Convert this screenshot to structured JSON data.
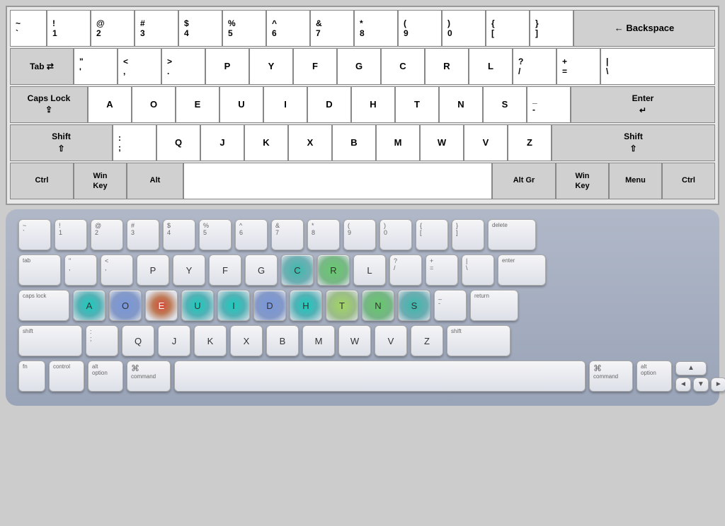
{
  "topKeyboard": {
    "rows": [
      {
        "id": "row1",
        "keys": [
          {
            "id": "tilde",
            "top": "~",
            "bot": "`",
            "cls": "r1-tilde"
          },
          {
            "id": "k1",
            "top": "!",
            "bot": "1",
            "cls": "r1-1"
          },
          {
            "id": "k2",
            "top": "@",
            "bot": "2",
            "cls": "r1-2"
          },
          {
            "id": "k3",
            "top": "#",
            "bot": "3",
            "cls": "r1-3"
          },
          {
            "id": "k4",
            "top": "$",
            "bot": "4",
            "cls": "r1-4"
          },
          {
            "id": "k5",
            "top": "%",
            "bot": "5",
            "cls": "r1-5"
          },
          {
            "id": "k6",
            "top": "^",
            "bot": "6",
            "cls": "r1-6"
          },
          {
            "id": "k7",
            "top": "&",
            "bot": "7",
            "cls": "r1-7"
          },
          {
            "id": "k8",
            "top": "*",
            "bot": "8",
            "cls": "r1-8"
          },
          {
            "id": "k9",
            "top": "(",
            "bot": "9",
            "cls": "r1-9"
          },
          {
            "id": "k0",
            "top": ")",
            "bot": "0",
            "cls": "r1-0"
          },
          {
            "id": "klb",
            "top": "{",
            "bot": "[",
            "cls": "r1-lb"
          },
          {
            "id": "krb",
            "top": "}",
            "bot": "]",
            "cls": "r1-rb"
          },
          {
            "id": "kbs",
            "label": "← Backspace",
            "cls": "r1-bs special"
          }
        ]
      },
      {
        "id": "row2",
        "keys": [
          {
            "id": "tab",
            "label": "Tab ⇄",
            "cls": "r2-tab special"
          },
          {
            "id": "kq",
            "top": "\"",
            "bot": "'",
            "cls": "r2-q"
          },
          {
            "id": "kw",
            "top": "<",
            "bot": ",",
            "cls": "r2-w"
          },
          {
            "id": "ke",
            "top": ">",
            "bot": ".",
            "cls": "r2-e"
          },
          {
            "id": "kr",
            "label": "P",
            "cls": "r2-r"
          },
          {
            "id": "kt",
            "label": "Y",
            "cls": "r2-t"
          },
          {
            "id": "ky",
            "label": "F",
            "cls": "r2-y"
          },
          {
            "id": "ku",
            "label": "G",
            "cls": "r2-u"
          },
          {
            "id": "ki",
            "label": "C",
            "cls": "r2-i"
          },
          {
            "id": "ko",
            "label": "R",
            "cls": "r2-o"
          },
          {
            "id": "kp",
            "label": "L",
            "cls": "r2-p"
          },
          {
            "id": "klb2",
            "top": "?",
            "bot": "/",
            "cls": "r2-lb2"
          },
          {
            "id": "krb2",
            "top": "+",
            "bot": "=",
            "cls": "r2-rb2"
          },
          {
            "id": "kbs2",
            "top": "|",
            "bot": "\\",
            "cls": "r2-bs2"
          }
        ]
      },
      {
        "id": "row3",
        "keys": [
          {
            "id": "caps",
            "label": "Caps Lock\n⇪",
            "cls": "r3-caps special"
          },
          {
            "id": "ka",
            "label": "A",
            "cls": "r3-a"
          },
          {
            "id": "ks",
            "label": "O",
            "cls": "r3-s"
          },
          {
            "id": "kd",
            "label": "E",
            "cls": "r3-d"
          },
          {
            "id": "kf",
            "label": "U",
            "cls": "r3-f"
          },
          {
            "id": "kg",
            "label": "I",
            "cls": "r3-g"
          },
          {
            "id": "kh",
            "label": "D",
            "cls": "r3-h"
          },
          {
            "id": "kj",
            "label": "H",
            "cls": "r3-j"
          },
          {
            "id": "kk",
            "label": "T",
            "cls": "r3-k"
          },
          {
            "id": "kl",
            "label": "N",
            "cls": "r3-l"
          },
          {
            "id": "ksc",
            "label": "S",
            "cls": "r3-sc"
          },
          {
            "id": "kap",
            "top": "_",
            "bot": "-",
            "cls": "r3-ap"
          },
          {
            "id": "kent",
            "label": "Enter\n↵",
            "cls": "r3-ent special"
          }
        ]
      },
      {
        "id": "row4",
        "keys": [
          {
            "id": "shift1",
            "label": "Shift\n⇧",
            "cls": "r4-shift1 special"
          },
          {
            "id": "kz",
            "top": ":",
            "bot": ";",
            "cls": "r4-z"
          },
          {
            "id": "kx",
            "label": "Q",
            "cls": "r4-x"
          },
          {
            "id": "kc",
            "label": "J",
            "cls": "r4-c"
          },
          {
            "id": "kv",
            "label": "K",
            "cls": "r4-v"
          },
          {
            "id": "kb",
            "label": "X",
            "cls": "r4-b"
          },
          {
            "id": "kn",
            "label": "B",
            "cls": "r4-n"
          },
          {
            "id": "km",
            "label": "M",
            "cls": "r4-m"
          },
          {
            "id": "kcm",
            "label": "W",
            "cls": "r4-cm"
          },
          {
            "id": "kdt",
            "label": "V",
            "cls": "r4-dt"
          },
          {
            "id": "ksl",
            "label": "Z",
            "cls": "r4-sl"
          },
          {
            "id": "shift2",
            "label": "Shift\n⇧",
            "cls": "r4-shift2 special"
          }
        ]
      },
      {
        "id": "row5",
        "keys": [
          {
            "id": "ctrl1",
            "label": "Ctrl",
            "cls": "r5-ctrl1 special"
          },
          {
            "id": "win1",
            "label": "Win\nKey",
            "cls": "r5-win1 special"
          },
          {
            "id": "alt1",
            "label": "Alt",
            "cls": "r5-alt1 special"
          },
          {
            "id": "space",
            "label": "",
            "cls": "r5-space"
          },
          {
            "id": "altgr",
            "label": "Alt Gr",
            "cls": "r5-altgr special"
          },
          {
            "id": "win2",
            "label": "Win\nKey",
            "cls": "r5-win2 special"
          },
          {
            "id": "menu",
            "label": "Menu",
            "cls": "r5-menu special"
          },
          {
            "id": "ctrl2",
            "label": "Ctrl",
            "cls": "r5-ctrl2 special"
          }
        ]
      }
    ]
  },
  "bottomKeyboard": {
    "row1": [
      {
        "id": "tilde",
        "top": "~",
        "bot": "`",
        "cls": "mn-tilde",
        "heat": ""
      },
      {
        "id": "n1",
        "top": "!",
        "bot": "1",
        "cls": "mn-num",
        "heat": ""
      },
      {
        "id": "n2",
        "top": "@",
        "bot": "2",
        "cls": "mn-num",
        "heat": ""
      },
      {
        "id": "n3",
        "top": "#",
        "bot": "3",
        "cls": "mn-num",
        "heat": ""
      },
      {
        "id": "n4",
        "top": "$",
        "bot": "4",
        "cls": "mn-num",
        "heat": ""
      },
      {
        "id": "n5",
        "top": "%",
        "bot": "5",
        "cls": "mn-num",
        "heat": ""
      },
      {
        "id": "n6",
        "top": "^",
        "bot": "6",
        "cls": "mn-num",
        "heat": ""
      },
      {
        "id": "n7",
        "top": "&",
        "bot": "7",
        "cls": "mn-num",
        "heat": ""
      },
      {
        "id": "n8",
        "top": "*",
        "bot": "8",
        "cls": "mn-num",
        "heat": ""
      },
      {
        "id": "n9",
        "top": "(",
        "bot": "9",
        "cls": "mn-num",
        "heat": ""
      },
      {
        "id": "n0",
        "top": ")",
        "bot": "0",
        "cls": "mn-num",
        "heat": ""
      },
      {
        "id": "nlb",
        "top": "{",
        "bot": "[",
        "cls": "mn-num",
        "heat": ""
      },
      {
        "id": "nrb",
        "top": "}",
        "bot": "]",
        "cls": "mn-num",
        "heat": ""
      },
      {
        "id": "ndel",
        "label": "delete",
        "cls": "mn-delete",
        "heat": ""
      }
    ],
    "row2": [
      {
        "id": "tab",
        "label": "tab",
        "cls": "mn-tab",
        "heat": ""
      },
      {
        "id": "r2q",
        "top": "\"",
        "bot": "'",
        "cls": "mn-letter",
        "heat": ""
      },
      {
        "id": "r2w",
        "top": "<",
        "bot": ",",
        "cls": "mn-letter",
        "heat": ""
      },
      {
        "id": "r2e",
        "label": "P",
        "cls": "mn-letter",
        "heat": ""
      },
      {
        "id": "r2r",
        "label": "Y",
        "cls": "mn-letter",
        "heat": ""
      },
      {
        "id": "r2t",
        "label": "F",
        "cls": "mn-letter",
        "heat": ""
      },
      {
        "id": "r2y",
        "label": "G",
        "cls": "mn-letter",
        "heat": ""
      },
      {
        "id": "r2u",
        "label": "C",
        "cls": "mn-letter",
        "heat": "hm-teal"
      },
      {
        "id": "r2i",
        "label": "R",
        "cls": "mn-letter",
        "heat": "hm-green"
      },
      {
        "id": "r2o",
        "label": "L",
        "cls": "mn-letter",
        "heat": ""
      },
      {
        "id": "r2p",
        "top": "?",
        "bot": "/",
        "cls": "mn-letter",
        "heat": ""
      },
      {
        "id": "r2lb",
        "top": "+",
        "bot": "=",
        "cls": "mn-letter",
        "heat": ""
      },
      {
        "id": "r2rb",
        "top": "|",
        "bot": "\\",
        "cls": "mn-letter",
        "heat": ""
      },
      {
        "id": "r2ent",
        "label": "enter",
        "cls": "mn-enter",
        "heat": ""
      }
    ],
    "row3": [
      {
        "id": "caps",
        "label": "caps lock",
        "cls": "mn-caps",
        "heat": ""
      },
      {
        "id": "r3a",
        "label": "A",
        "cls": "mn-letter",
        "heat": "hm-cyan"
      },
      {
        "id": "r3o",
        "label": "O",
        "cls": "mn-letter",
        "heat": "hm-blue"
      },
      {
        "id": "r3e",
        "label": "E",
        "cls": "mn-letter",
        "heat": "hm-red-center"
      },
      {
        "id": "r3u",
        "label": "U",
        "cls": "mn-letter",
        "heat": "hm-cyan"
      },
      {
        "id": "r3i",
        "label": "I",
        "cls": "mn-letter",
        "heat": "hm-cyan"
      },
      {
        "id": "r3d",
        "label": "D",
        "cls": "mn-letter",
        "heat": "hm-blue"
      },
      {
        "id": "r3h",
        "label": "H",
        "cls": "mn-letter",
        "heat": "hm-cyan"
      },
      {
        "id": "r3t",
        "label": "T",
        "cls": "mn-letter",
        "heat": "hm-yellow-green"
      },
      {
        "id": "r3n",
        "label": "N",
        "cls": "mn-letter",
        "heat": "hm-green"
      },
      {
        "id": "r3s",
        "label": "S",
        "cls": "mn-letter",
        "heat": "hm-teal"
      },
      {
        "id": "r3dash",
        "top": "_",
        "bot": "-",
        "cls": "mn-letter",
        "heat": ""
      },
      {
        "id": "r3ret",
        "label": "return",
        "cls": "mn-return",
        "heat": ""
      }
    ],
    "row4": [
      {
        "id": "shift1",
        "label": "shift",
        "cls": "mn-shift",
        "heat": ""
      },
      {
        "id": "r4sc",
        "top": ":",
        "bot": ";",
        "cls": "mn-letter",
        "heat": ""
      },
      {
        "id": "r4q",
        "label": "Q",
        "cls": "mn-letter",
        "heat": ""
      },
      {
        "id": "r4j",
        "label": "J",
        "cls": "mn-letter",
        "heat": ""
      },
      {
        "id": "r4k",
        "label": "K",
        "cls": "mn-letter",
        "heat": ""
      },
      {
        "id": "r4x",
        "label": "X",
        "cls": "mn-letter",
        "heat": ""
      },
      {
        "id": "r4b",
        "label": "B",
        "cls": "mn-letter",
        "heat": ""
      },
      {
        "id": "r4m",
        "label": "M",
        "cls": "mn-letter",
        "heat": ""
      },
      {
        "id": "r4w",
        "label": "W",
        "cls": "mn-letter",
        "heat": ""
      },
      {
        "id": "r4v",
        "label": "V",
        "cls": "mn-letter",
        "heat": ""
      },
      {
        "id": "r4z",
        "label": "Z",
        "cls": "mn-letter",
        "heat": ""
      },
      {
        "id": "shift2",
        "label": "shift",
        "cls": "mn-shift2",
        "heat": ""
      }
    ],
    "row5": [
      {
        "id": "fn",
        "label": "fn",
        "cls": "mn-fn",
        "heat": ""
      },
      {
        "id": "ctrl",
        "label": "control",
        "cls": "mn-ctrl",
        "heat": ""
      },
      {
        "id": "alt",
        "label": "alt\noption",
        "cls": "mn-alt",
        "heat": ""
      },
      {
        "id": "cmd1",
        "label": "⌘\ncommand",
        "cls": "mn-cmd",
        "heat": ""
      },
      {
        "id": "space",
        "label": "",
        "cls": "mn-space",
        "heat": ""
      },
      {
        "id": "cmd2",
        "label": "⌘\ncommand",
        "cls": "mn-cmd",
        "heat": ""
      },
      {
        "id": "alt2",
        "label": "alt\noption",
        "cls": "mn-alt",
        "heat": ""
      }
    ]
  }
}
